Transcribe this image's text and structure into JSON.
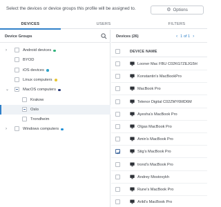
{
  "header": {
    "description": "Select the devices or device groups this profile will be assigned to.",
    "options_label": "Options"
  },
  "tabs": [
    {
      "label": "DEVICES",
      "active": true
    },
    {
      "label": "USERS",
      "active": false
    },
    {
      "label": "FILTERS",
      "active": false
    }
  ],
  "device_groups": {
    "title": "Device Groups",
    "items": [
      {
        "label": "Android devices",
        "level": 0,
        "expand": "collapsed",
        "checkbox": "empty",
        "dot_color": "#2fb37a",
        "selected": false
      },
      {
        "label": "BYOD",
        "level": 0,
        "expand": "none",
        "checkbox": "empty",
        "dot_color": null,
        "selected": false
      },
      {
        "label": "iOS devices",
        "level": 0,
        "expand": "none",
        "checkbox": "empty",
        "dot_color": "#2fa3c9",
        "selected": false
      },
      {
        "label": "Linux computers",
        "level": 0,
        "expand": "none",
        "checkbox": "empty",
        "dot_color": "#e7c534",
        "selected": false
      },
      {
        "label": "MacOS computers",
        "level": 0,
        "expand": "expanded",
        "checkbox": "partial",
        "dot_color": "#2b3b7a",
        "selected": false
      },
      {
        "label": "Krakow",
        "level": 1,
        "expand": "none",
        "checkbox": "empty",
        "dot_color": null,
        "selected": false
      },
      {
        "label": "Oslo",
        "level": 1,
        "expand": "none",
        "checkbox": "partial",
        "dot_color": null,
        "selected": true
      },
      {
        "label": "Trondheim",
        "level": 1,
        "expand": "none",
        "checkbox": "empty",
        "dot_color": null,
        "selected": false
      },
      {
        "label": "Windows computers",
        "level": 0,
        "expand": "collapsed",
        "checkbox": "empty",
        "dot_color": "#1f8fd6",
        "selected": false
      }
    ]
  },
  "devices": {
    "title": "Devices (26)",
    "pager": {
      "prev_icon": "chevron-left-icon",
      "page_text": "1 of 1",
      "next_icon": "chevron-right-icon"
    },
    "column_header": "DEVICE NAME",
    "rows": [
      {
        "name": "Looner Mac FBU C02KG7ZEJG5H",
        "checked": false
      },
      {
        "name": "Konstantin's MacBookPro",
        "checked": false
      },
      {
        "name": "MacBook Pro",
        "checked": false
      },
      {
        "name": "Telenor Digital C02ZMY6MD6M",
        "checked": false
      },
      {
        "name": "Ayesha's MacBook Pro",
        "checked": false
      },
      {
        "name": "Olgas MacBook Pro",
        "checked": false
      },
      {
        "name": "Amin's MacBook Pro",
        "checked": false
      },
      {
        "name": "Stig's MacBook Pro",
        "checked": true
      },
      {
        "name": "trond's MacBook Pro",
        "checked": false
      },
      {
        "name": "Andrey Mostovykh",
        "checked": false
      },
      {
        "name": "Rune's MacBook Pro",
        "checked": false
      },
      {
        "name": "Arild's MacBook Pro",
        "checked": false
      }
    ]
  }
}
